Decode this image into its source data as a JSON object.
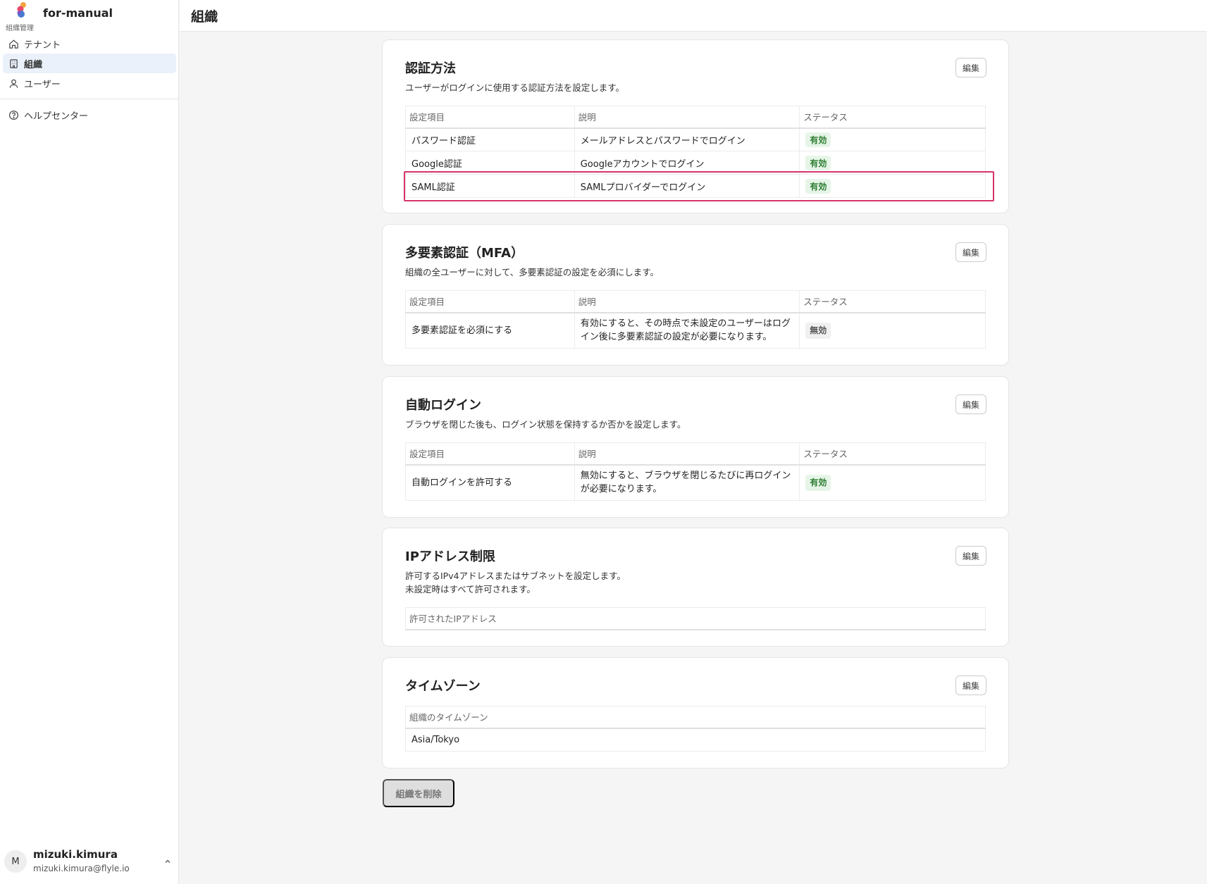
{
  "app": {
    "name": "for-manual",
    "subtitle": "組織管理"
  },
  "sidebar": {
    "items": [
      {
        "label": "テナント",
        "icon": "home-icon"
      },
      {
        "label": "組織",
        "icon": "building-icon",
        "active": true
      },
      {
        "label": "ユーザー",
        "icon": "user-icon"
      }
    ],
    "help": {
      "label": "ヘルプセンター",
      "icon": "help-circle-icon"
    }
  },
  "user": {
    "initial": "M",
    "name": "mizuki.kimura",
    "email": "mizuki.kimura@flyle.io"
  },
  "header": {
    "title": "組織"
  },
  "edit_label": "編集",
  "columns": {
    "item": "設定項目",
    "desc": "説明",
    "status": "ステータス"
  },
  "auth": {
    "title": "認証方法",
    "description": "ユーザーがログインに使用する認証方法を設定します。",
    "rows": [
      {
        "item": "パスワード認証",
        "desc": "メールアドレスとパスワードでログイン",
        "status": "有効"
      },
      {
        "item": "Google認証",
        "desc": "Googleアカウントでログイン",
        "status": "有効"
      },
      {
        "item": "SAML認証",
        "desc": "SAMLプロバイダーでログイン",
        "status": "有効"
      }
    ]
  },
  "mfa": {
    "title": "多要素認証（MFA）",
    "description": "組織の全ユーザーに対して、多要素認証の設定を必須にします。",
    "rows": [
      {
        "item": "多要素認証を必須にする",
        "desc": "有効にすると、その時点で未設定のユーザーはログイン後に多要素認証の設定が必要になります。",
        "status": "無効"
      }
    ]
  },
  "autologin": {
    "title": "自動ログイン",
    "description": "ブラウザを閉じた後も、ログイン状態を保持するか否かを設定します。",
    "rows": [
      {
        "item": "自動ログインを許可する",
        "desc": "無効にすると、ブラウザを閉じるたびに再ログインが必要になります。",
        "status": "有効"
      }
    ]
  },
  "ip": {
    "title": "IPアドレス制限",
    "description_line1": "許可するIPv4アドレスまたはサブネットを設定します。",
    "description_line2": "未設定時はすべて許可されます。",
    "column": "許可されたIPアドレス"
  },
  "timezone": {
    "title": "タイムゾーン",
    "column": "組織のタイムゾーン",
    "value": "Asia/Tokyo"
  },
  "delete_label": "組織を削除",
  "colors": {
    "accent": "#d6336c",
    "active_bg": "#ebf1fb",
    "badge_on": "#2e7d32"
  }
}
